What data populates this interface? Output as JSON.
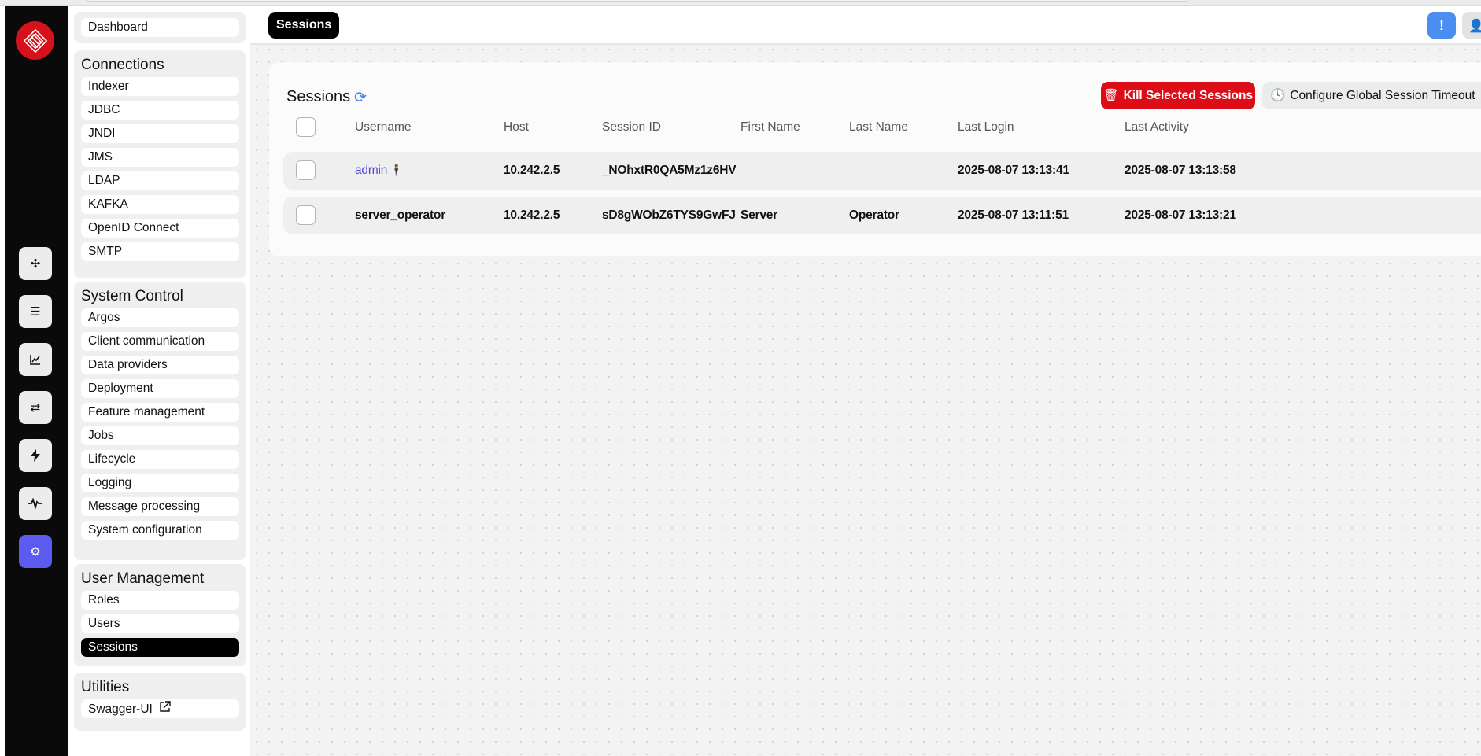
{
  "rail": {
    "items": [
      {
        "icon": "apps-icon",
        "glyph": "✣"
      },
      {
        "icon": "list-icon",
        "glyph": "☰"
      },
      {
        "icon": "chart-icon",
        "glyph": "📈"
      },
      {
        "icon": "swap-icon",
        "glyph": "⇄"
      },
      {
        "icon": "bolt-icon",
        "glyph": "⚡"
      },
      {
        "icon": "pulse-icon",
        "glyph": "∿"
      },
      {
        "icon": "gear-icon",
        "glyph": "⚙"
      }
    ],
    "active_color": "#5b5bf0",
    "logo_color": "#d5121b"
  },
  "nav": {
    "dashboard": "Dashboard",
    "connections": {
      "title": "Connections",
      "items": [
        "Indexer",
        "JDBC",
        "JNDI",
        "JMS",
        "LDAP",
        "KAFKA",
        "OpenID Connect",
        "SMTP"
      ]
    },
    "system_control": {
      "title": "System Control",
      "items": [
        "Argos",
        "Client communication",
        "Data providers",
        "Deployment",
        "Feature management",
        "Jobs",
        "Lifecycle",
        "Logging",
        "Message processing",
        "System configuration"
      ]
    },
    "user_management": {
      "title": "User Management",
      "items": [
        "Roles",
        "Users",
        "Sessions"
      ]
    },
    "utilities": {
      "title": "Utilities",
      "items": [
        "Swagger-UI"
      ]
    }
  },
  "header": {
    "crumb": "Sessions",
    "alert_glyph": "!",
    "user_glyph": "👤"
  },
  "card": {
    "title": "Sessions",
    "kill_label": "Kill Selected Sessions",
    "configure_label": "Configure Global Session Timeout",
    "kill_color": "#dc0d17"
  },
  "table": {
    "columns": [
      "Username",
      "Host",
      "Session ID",
      "First Name",
      "Last Name",
      "Last Login",
      "Last Activity"
    ],
    "rows": [
      {
        "username": "admin",
        "host": "10.242.2.5",
        "session_id": "_NOhxtR0QA5Mz1z6HV…",
        "first_name": "",
        "last_name": "",
        "last_login": "2025-08-07 13:13:41",
        "last_activity": "2025-08-07 13:13:58"
      },
      {
        "username": "server_operator",
        "host": "10.242.2.5",
        "session_id": "sD8gWObZ6TYS9GwFJ…",
        "first_name": "Server",
        "last_name": "Operator",
        "last_login": "2025-08-07 13:11:51",
        "last_activity": "2025-08-07 13:13:21"
      }
    ]
  }
}
